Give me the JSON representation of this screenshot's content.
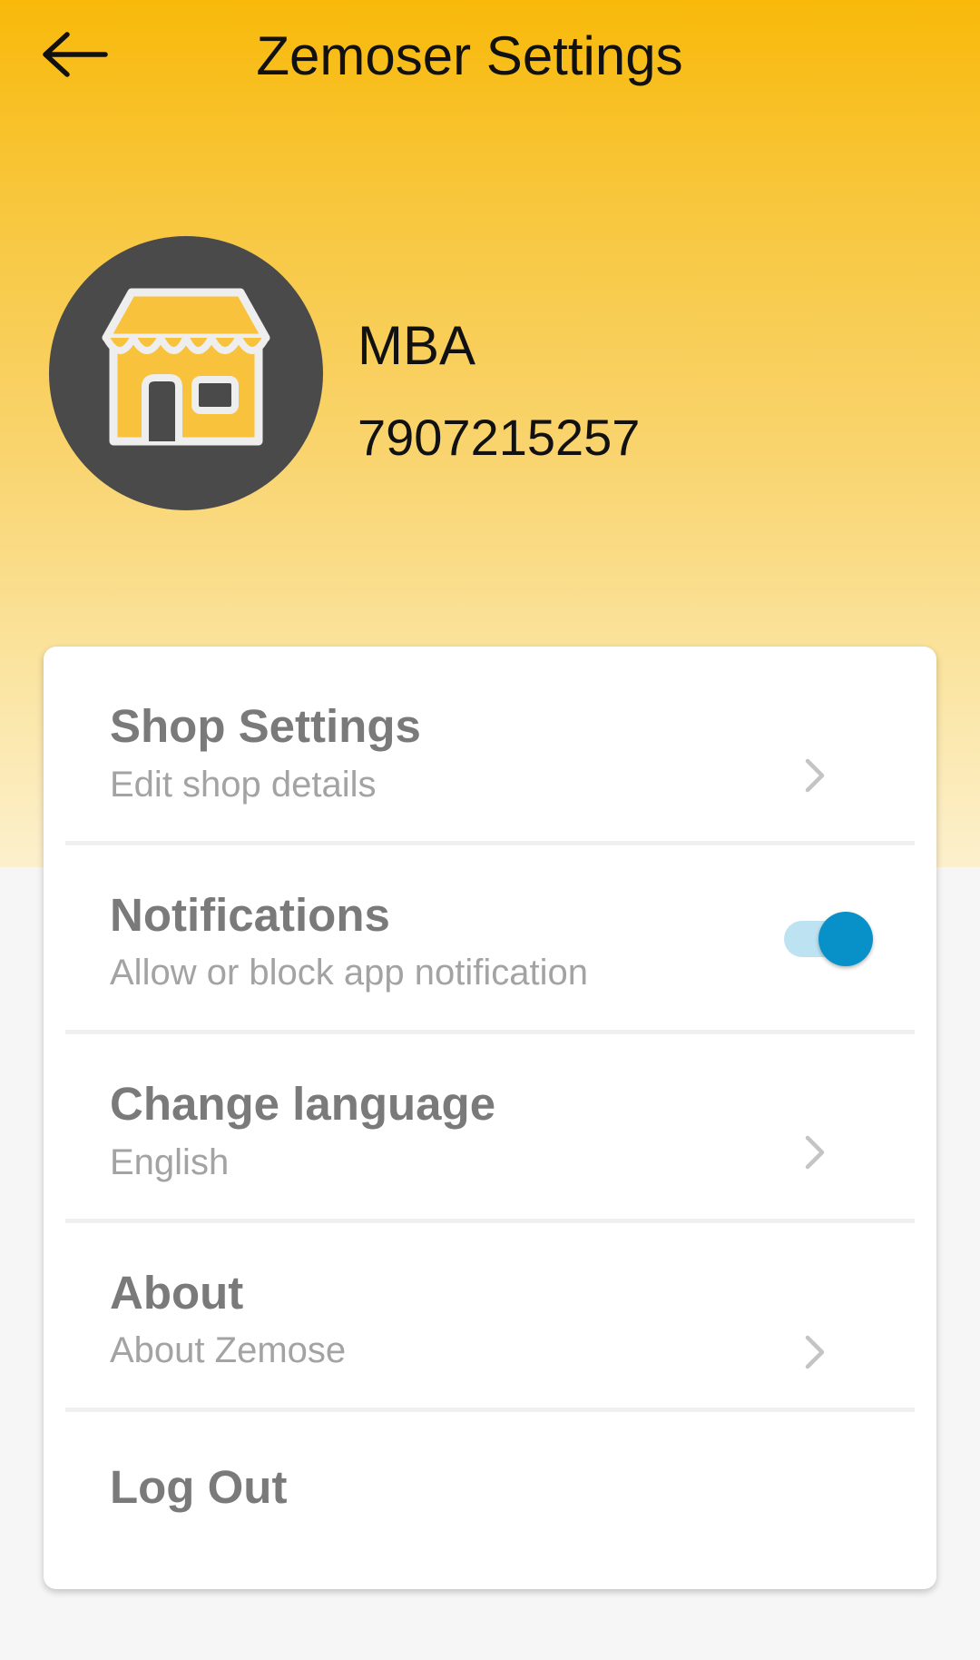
{
  "header": {
    "title": "Zemoser Settings",
    "back_icon": "arrow-left-icon",
    "background_colors": [
      "#f8b90a",
      "#fcf0cd"
    ]
  },
  "profile": {
    "avatar_icon": "shop-icon",
    "name": "MBA",
    "phone": "7907215257"
  },
  "settings": {
    "shop_settings": {
      "title": "Shop Settings",
      "subtitle": "Edit shop details",
      "icon": "chevron-right-icon"
    },
    "notifications": {
      "title": "Notifications",
      "subtitle": "Allow or block app notification",
      "toggle_on": true,
      "toggle_color": "#0891c9"
    },
    "change_language": {
      "title": "Change language",
      "subtitle": "English",
      "icon": "chevron-right-icon"
    },
    "about": {
      "title": "About",
      "subtitle": "About Zemose",
      "icon": "chevron-right-icon"
    },
    "logout": {
      "title": "Log Out"
    }
  }
}
